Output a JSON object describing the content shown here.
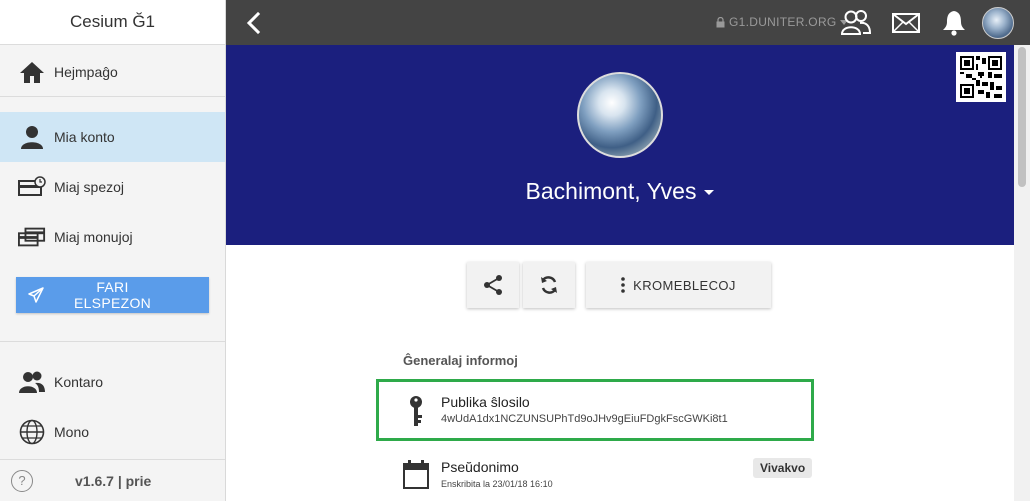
{
  "app": {
    "title": "Cesium Ğ1"
  },
  "sidebar": {
    "items": [
      {
        "label": "Hejmpaĝo",
        "icon": "home-icon"
      },
      {
        "label": "Mia konto",
        "icon": "user-icon",
        "active": true
      },
      {
        "label": "Miaj spezoj",
        "icon": "card-history-icon"
      },
      {
        "label": "Miaj monujoj",
        "icon": "wallets-icon"
      },
      {
        "label": "Kontaro",
        "icon": "contacts-icon"
      },
      {
        "label": "Mono",
        "icon": "globe-icon"
      }
    ],
    "send_button": "FARI ELSPEZON",
    "help": "?",
    "version": "v1.6.7 | prie"
  },
  "topbar": {
    "node": "G1.DUNITER.ORG",
    "icons": [
      "back-icon",
      "lock-icon",
      "users-icon",
      "mail-icon",
      "bell-icon",
      "avatar"
    ]
  },
  "profile": {
    "name": "Bachimont, Yves"
  },
  "actions": {
    "more_label": "KROMEBLECOJ"
  },
  "info": {
    "section_title": "Ĝeneralaj informoj",
    "pubkey_label": "Publika ŝlosilo",
    "pubkey_value": "4wUdA1dx1NCZUNSUPhTd9oJHv9gEiuFDgkFscGWKi8t1",
    "pseudonym_label": "Pseŭdonimo",
    "pseudonym_sub": "Enskribita la 23/01/18 16:10",
    "pseudonym_value": "Vivakvo"
  },
  "colors": {
    "topbar": "#444444",
    "hero": "#1b1f7e",
    "active_nav": "#cfe6f5",
    "send_button": "#5a9cea",
    "highlight": "#2eaa4a"
  }
}
